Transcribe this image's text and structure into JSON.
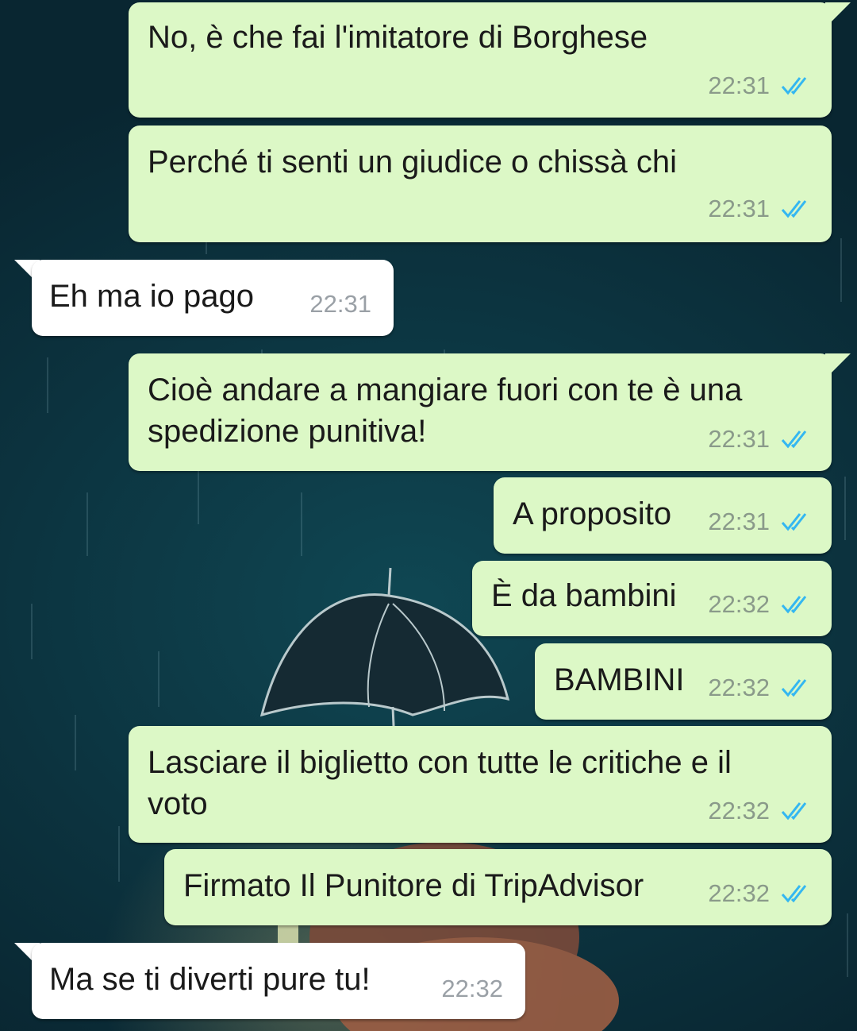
{
  "chat": {
    "messages": [
      {
        "direction": "outgoing",
        "text": "No, è che fai l'imitatore di Borghese",
        "time": "22:31",
        "status_icon": "double-check-read-icon"
      },
      {
        "direction": "outgoing",
        "text": "Perché ti senti un giudice o chissà chi",
        "time": "22:31",
        "status_icon": "double-check-read-icon"
      },
      {
        "direction": "incoming",
        "text": "Eh ma io pago",
        "time": "22:31"
      },
      {
        "direction": "outgoing",
        "text": "Cioè andare a mangiare fuori con te è una\nspedizione punitiva!",
        "time": "22:31",
        "status_icon": "double-check-read-icon"
      },
      {
        "direction": "outgoing",
        "text": "A proposito",
        "time": "22:31",
        "status_icon": "double-check-read-icon"
      },
      {
        "direction": "outgoing",
        "text": "È da bambini",
        "time": "22:32",
        "status_icon": "double-check-read-icon"
      },
      {
        "direction": "outgoing",
        "text": "BAMBINI",
        "time": "22:32",
        "status_icon": "double-check-read-icon"
      },
      {
        "direction": "outgoing",
        "text": "Lasciare il biglietto con tutte le critiche e il\nvoto",
        "time": "22:32",
        "status_icon": "double-check-read-icon"
      },
      {
        "direction": "outgoing",
        "text": "Firmato Il Punitore di TripAdvisor",
        "time": "22:32",
        "status_icon": "double-check-read-icon"
      },
      {
        "direction": "incoming",
        "text": "Ma se ti diverti pure tu!",
        "time": "22:32"
      }
    ]
  },
  "colors": {
    "outgoing_bubble": "#dcf8c6",
    "incoming_bubble": "#ffffff",
    "read_ticks": "#34b7f1",
    "wallpaper": "#0d3340"
  },
  "wallpaper": {
    "icon": "umbrella-wallpaper-icon"
  }
}
